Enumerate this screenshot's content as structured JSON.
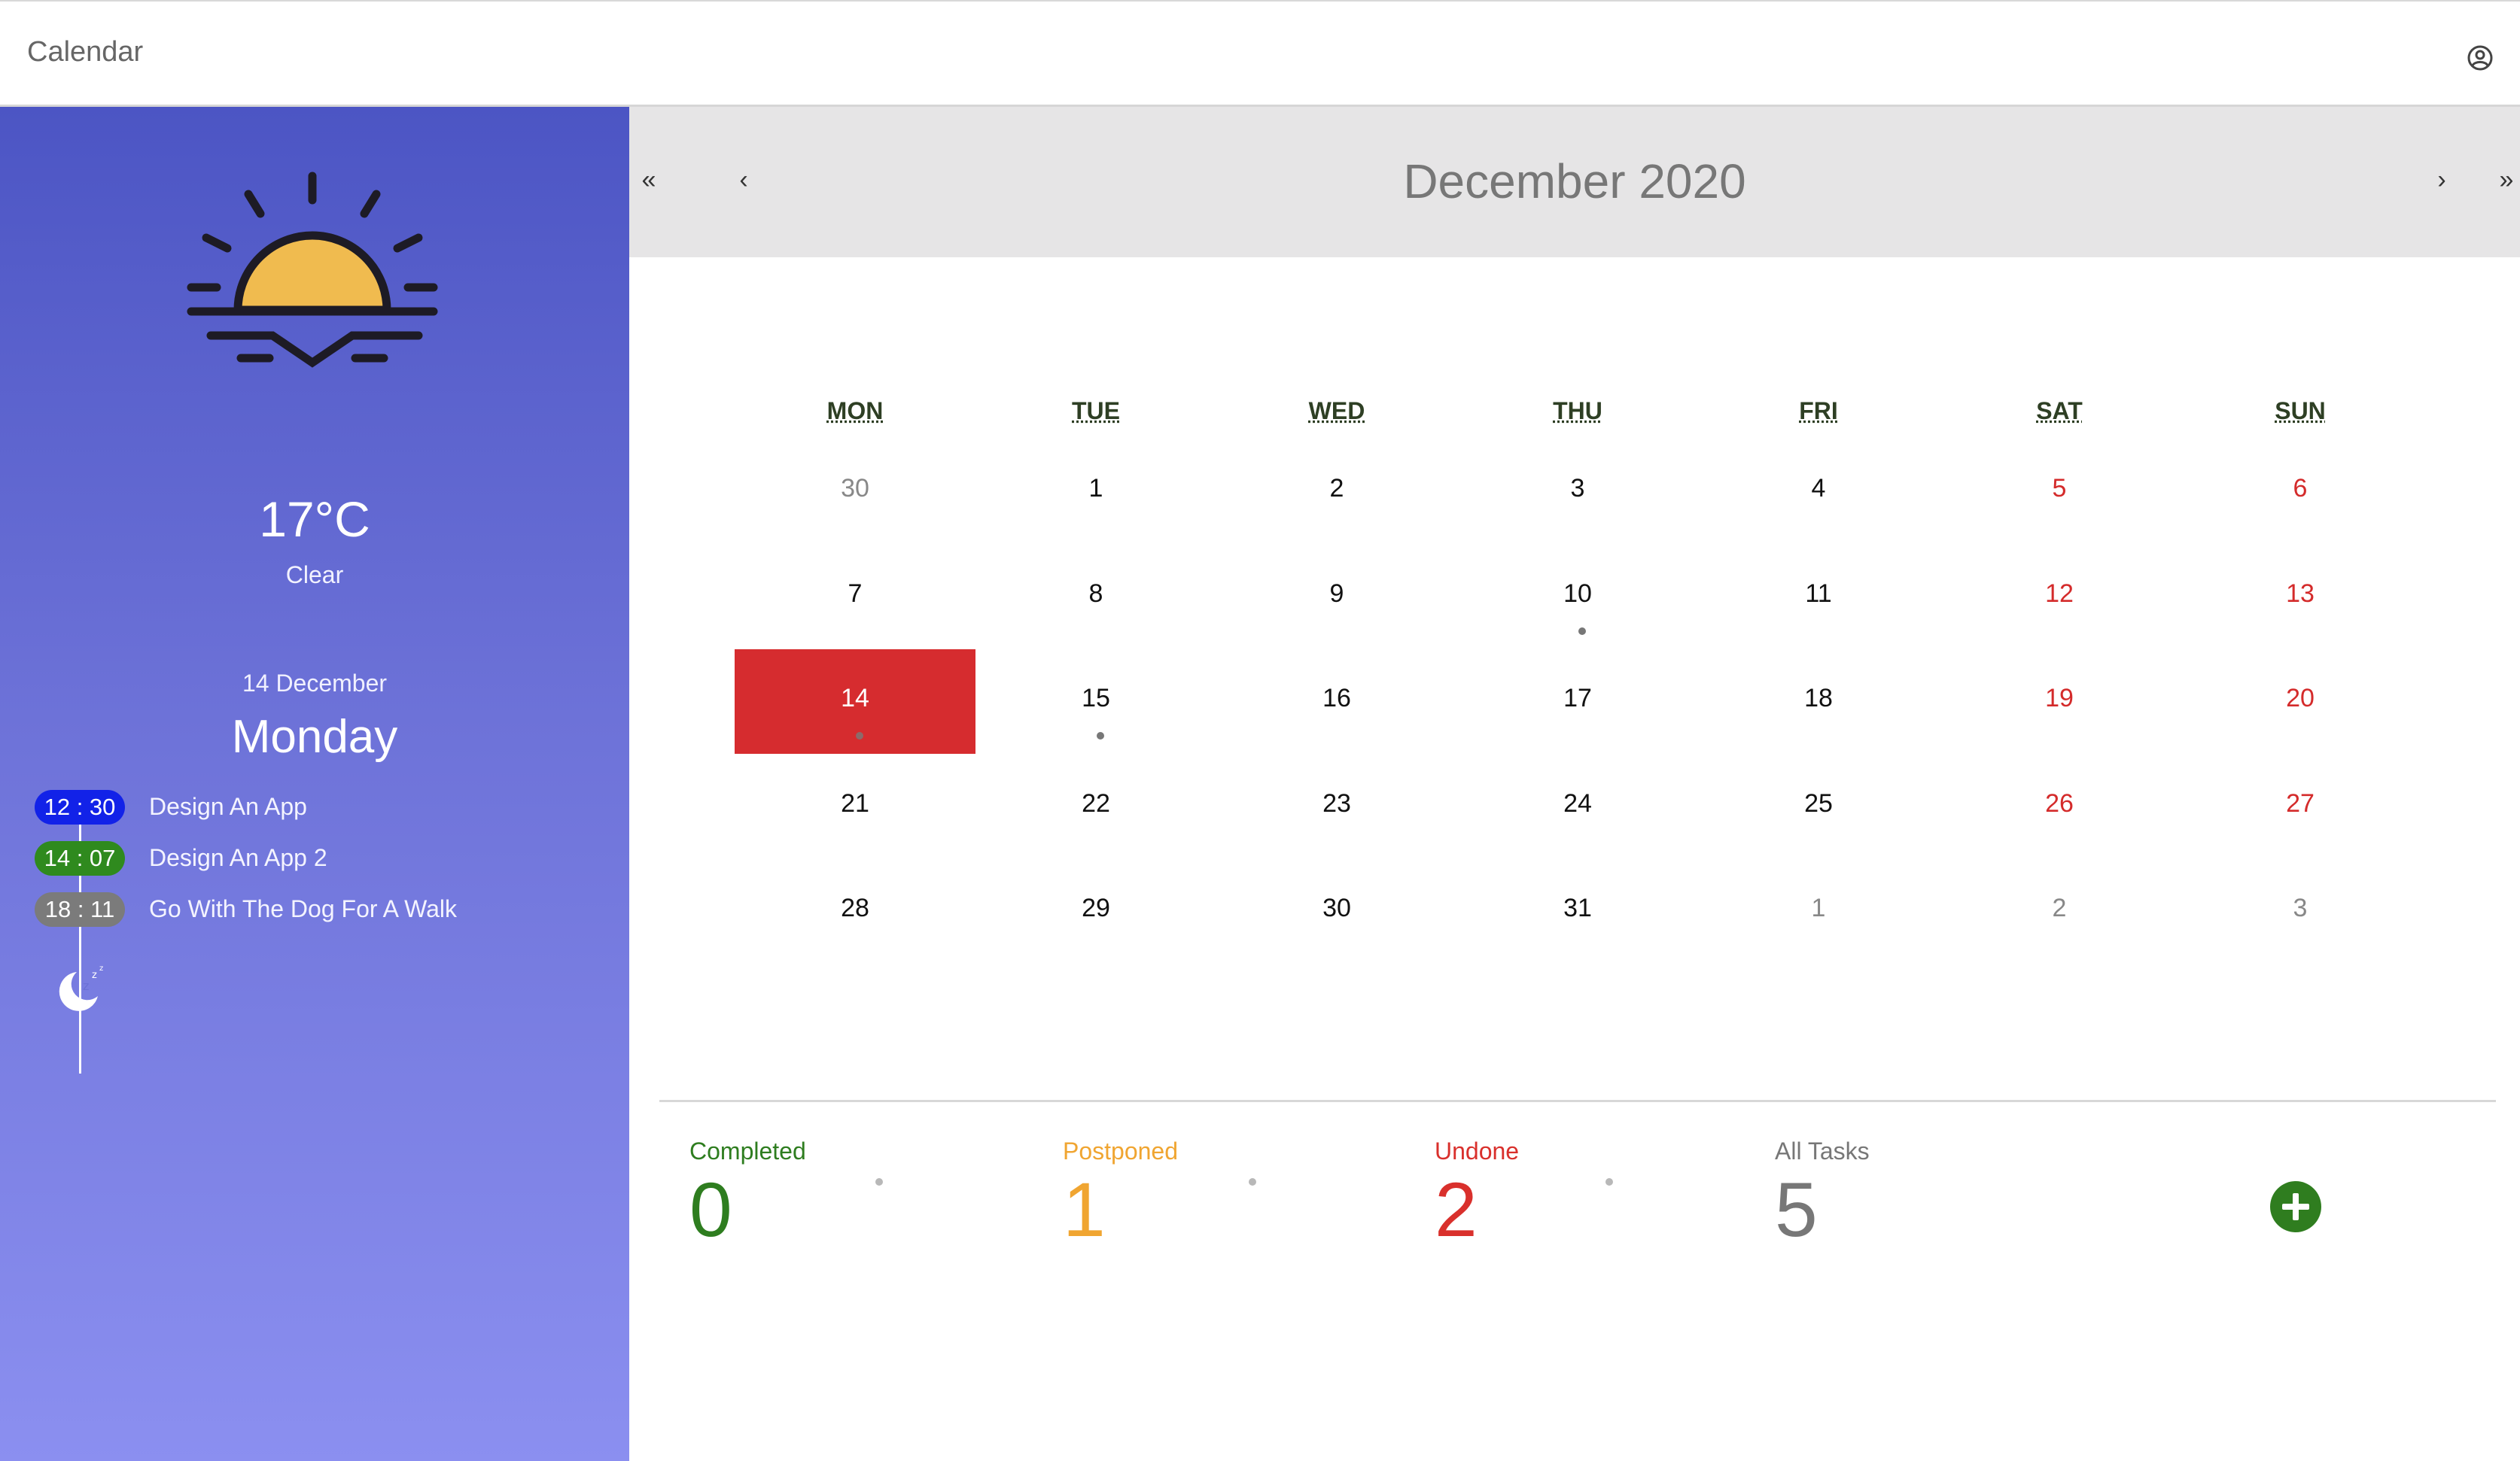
{
  "app": {
    "title": "Calendar",
    "account_icon": "account-circle-icon"
  },
  "weather": {
    "icon": "sunset-icon",
    "temperature": "17°C",
    "condition": "Clear",
    "date": "14 December",
    "weekday": "Monday"
  },
  "schedule": {
    "tasks": [
      {
        "time": "12 : 30",
        "title": "Design An App",
        "color": "#1222e8"
      },
      {
        "time": "14 : 07",
        "title": "Design An App 2",
        "color": "#2f8a1e"
      },
      {
        "time": "18 : 11",
        "title": "Go With The Dog For A Walk",
        "color": "#7b7b7b"
      }
    ],
    "end_icon": "sleep-moon-icon"
  },
  "calendar": {
    "month_title": "December 2020",
    "nav": {
      "prev_year": "«",
      "prev_month": "‹",
      "next_month": "›",
      "next_year": "»"
    },
    "weekdays": [
      "MON",
      "TUE",
      "WED",
      "THU",
      "FRI",
      "SAT",
      "SUN"
    ],
    "weeks": [
      [
        {
          "d": "30",
          "other": true
        },
        {
          "d": "1"
        },
        {
          "d": "2"
        },
        {
          "d": "3"
        },
        {
          "d": "4"
        },
        {
          "d": "5",
          "weekend": true
        },
        {
          "d": "6",
          "weekend": true
        }
      ],
      [
        {
          "d": "7"
        },
        {
          "d": "8"
        },
        {
          "d": "9"
        },
        {
          "d": "10",
          "event": true
        },
        {
          "d": "11"
        },
        {
          "d": "12",
          "weekend": true
        },
        {
          "d": "13",
          "weekend": true
        }
      ],
      [
        {
          "d": "14",
          "today": true,
          "event": true
        },
        {
          "d": "15",
          "event": true
        },
        {
          "d": "16"
        },
        {
          "d": "17"
        },
        {
          "d": "18"
        },
        {
          "d": "19",
          "weekend": true
        },
        {
          "d": "20",
          "weekend": true
        }
      ],
      [
        {
          "d": "21"
        },
        {
          "d": "22"
        },
        {
          "d": "23"
        },
        {
          "d": "24"
        },
        {
          "d": "25"
        },
        {
          "d": "26",
          "weekend": true
        },
        {
          "d": "27",
          "weekend": true
        }
      ],
      [
        {
          "d": "28"
        },
        {
          "d": "29"
        },
        {
          "d": "30"
        },
        {
          "d": "31"
        },
        {
          "d": "1",
          "other": true
        },
        {
          "d": "2",
          "other": true
        },
        {
          "d": "3",
          "other": true
        }
      ]
    ]
  },
  "stats": {
    "completed": {
      "label": "Completed",
      "value": "0",
      "color": "#2e7d1f"
    },
    "postponed": {
      "label": "Postponed",
      "value": "1",
      "color": "#f0a531"
    },
    "undone": {
      "label": "Undone",
      "value": "2",
      "color": "#d9302c"
    },
    "all": {
      "label": "All Tasks",
      "value": "5",
      "color": "#777777"
    },
    "add_icon": "plus-circle-icon"
  }
}
